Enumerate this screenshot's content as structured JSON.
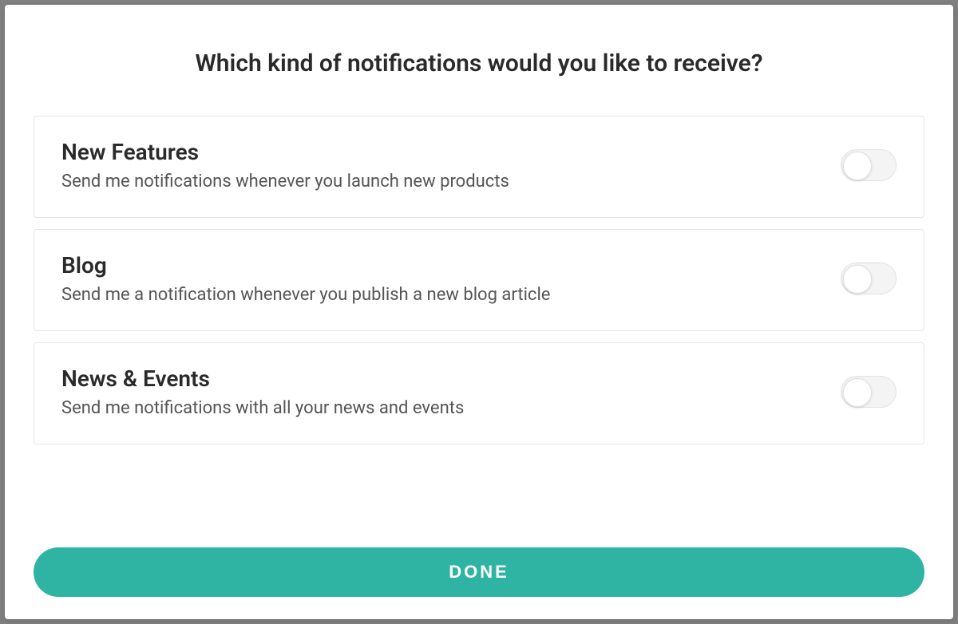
{
  "title": "Which kind of notifications would you like to receive?",
  "options": [
    {
      "title": "New Features",
      "description": "Send me notifications whenever you launch new products",
      "enabled": false
    },
    {
      "title": "Blog",
      "description": "Send me a notification whenever you publish a new blog article",
      "enabled": false
    },
    {
      "title": "News & Events",
      "description": "Send me notifications with all your news and events",
      "enabled": false
    }
  ],
  "button": {
    "done_label": "DONE"
  },
  "colors": {
    "accent": "#2fb3a3"
  }
}
